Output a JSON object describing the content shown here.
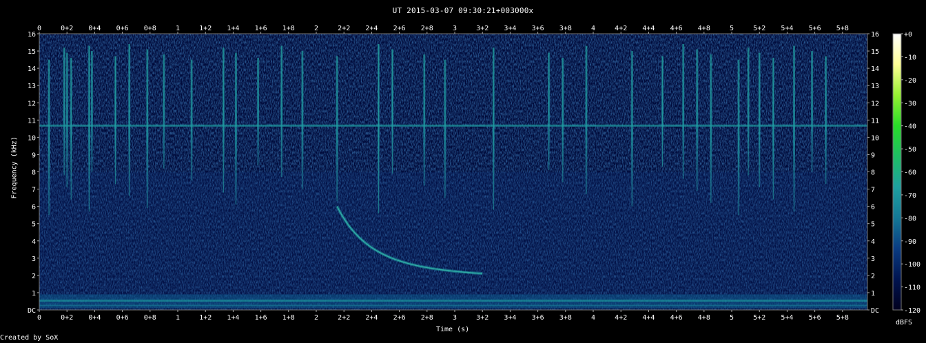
{
  "title": "UT 2015-03-07 09:30:21+003000x",
  "credit": "Created by SoX",
  "chart_data": {
    "type": "heatmap",
    "title": "UT 2015-03-07 09:30:21+003000x",
    "xlabel": "Time (s)",
    "ylabel": "Frequency (kHz)",
    "colorbar_label": "dBFS",
    "xlim": [
      0,
      5.98
    ],
    "ylim": [
      0,
      16
    ],
    "x_ticks": [
      "0",
      "0+2",
      "0+4",
      "0+6",
      "0+8",
      "1",
      "1+2",
      "1+4",
      "1+6",
      "1+8",
      "2",
      "2+2",
      "2+4",
      "2+6",
      "2+8",
      "3",
      "3+2",
      "3+4",
      "3+6",
      "3+8",
      "4",
      "4+2",
      "4+4",
      "4+6",
      "4+8",
      "5",
      "5+2",
      "5+4",
      "5+6",
      "5+8"
    ],
    "y_ticks": [
      "DC",
      "1",
      "2",
      "3",
      "4",
      "5",
      "6",
      "7",
      "8",
      "9",
      "10",
      "11",
      "12",
      "13",
      "14",
      "15",
      "16"
    ],
    "colorbar_ticks": [
      "+0",
      "-10",
      "-20",
      "-30",
      "-40",
      "-50",
      "-60",
      "-70",
      "-80",
      "-90",
      "-100",
      "-110",
      "-120"
    ],
    "colorbar_range": [
      -120,
      0
    ],
    "colormap": [
      "#00001e",
      "#001450",
      "#0a3c82",
      "#147896",
      "#1ea0a0",
      "#1ebe64",
      "#28dc28",
      "#96f032",
      "#ffff96",
      "#ffffff"
    ],
    "features": {
      "narrowband_line_khz": 10.7,
      "low_band_khz": [
        0.1,
        0.9
      ],
      "sweep": {
        "start_time_s": 2.15,
        "start_freq_khz": 6.0,
        "end_time_s": 2.95,
        "end_freq_khz": 2.1
      },
      "impulses_s": [
        0.07,
        0.18,
        0.2,
        0.23,
        0.36,
        0.38,
        0.55,
        0.65,
        0.78,
        0.9,
        1.1,
        1.33,
        1.42,
        1.58,
        1.75,
        1.9,
        2.15,
        2.45,
        2.55,
        2.78,
        2.93,
        3.28,
        3.68,
        3.78,
        3.95,
        4.28,
        4.5,
        4.65,
        4.75,
        4.85,
        5.05,
        5.12,
        5.2,
        5.3,
        5.45,
        5.58,
        5.68
      ]
    }
  }
}
